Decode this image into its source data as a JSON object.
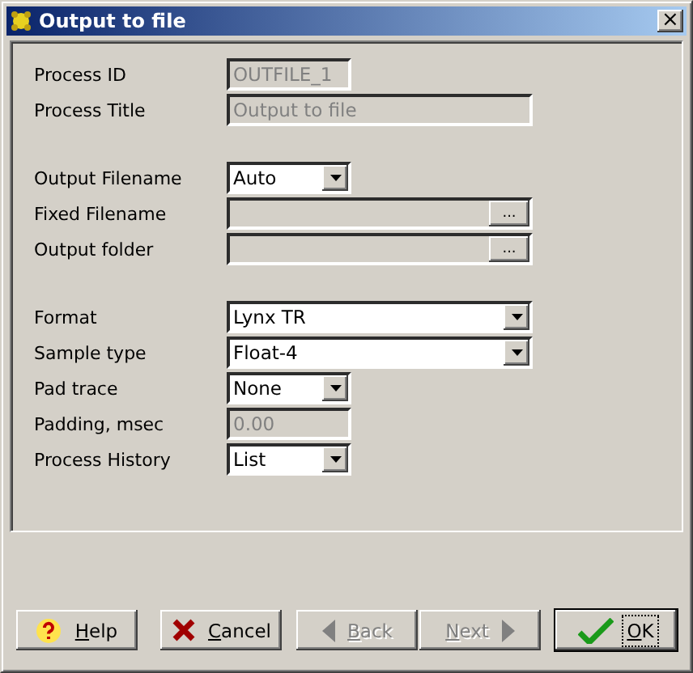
{
  "window": {
    "title": "Output to file",
    "close": "×"
  },
  "sections": [
    [
      {
        "label": "Process ID",
        "kind": "text",
        "value": "OUTFILE_1",
        "wide": false,
        "disabled": true
      },
      {
        "label": "Process Title",
        "kind": "text",
        "value": "Output to file",
        "wide": true,
        "disabled": true
      }
    ],
    [
      {
        "label": "Output Filename",
        "kind": "combo",
        "value": "Auto",
        "wide": false,
        "disabled": false
      },
      {
        "label": "Fixed Filename",
        "kind": "browse",
        "browse": "...",
        "wide": true,
        "disabled": true
      },
      {
        "label": "Output folder",
        "kind": "browse",
        "browse": "...",
        "wide": true,
        "disabled": true
      }
    ],
    [
      {
        "label": "Format",
        "kind": "combo",
        "value": "Lynx TR",
        "wide": true,
        "disabled": false
      },
      {
        "label": "Sample type",
        "kind": "combo",
        "value": "Float-4",
        "wide": true,
        "disabled": false
      },
      {
        "label": "Pad trace",
        "kind": "combo",
        "value": "None",
        "wide": false,
        "disabled": false
      },
      {
        "label": "Padding, msec",
        "kind": "text",
        "value": "0.00",
        "wide": false,
        "disabled": true
      },
      {
        "label": "Process History",
        "kind": "combo",
        "value": "List",
        "wide": false,
        "disabled": false
      }
    ]
  ],
  "buttons": [
    {
      "label": "Help",
      "kind": "help",
      "disabled": false,
      "default": false
    },
    {
      "label": "Cancel",
      "kind": "cancel",
      "disabled": false,
      "default": false
    },
    {
      "label": "Back",
      "kind": "back",
      "disabled": true,
      "default": false
    },
    {
      "label": "Next",
      "kind": "next",
      "disabled": true,
      "default": false
    },
    {
      "label": "OK",
      "kind": "ok",
      "disabled": false,
      "default": true
    }
  ]
}
